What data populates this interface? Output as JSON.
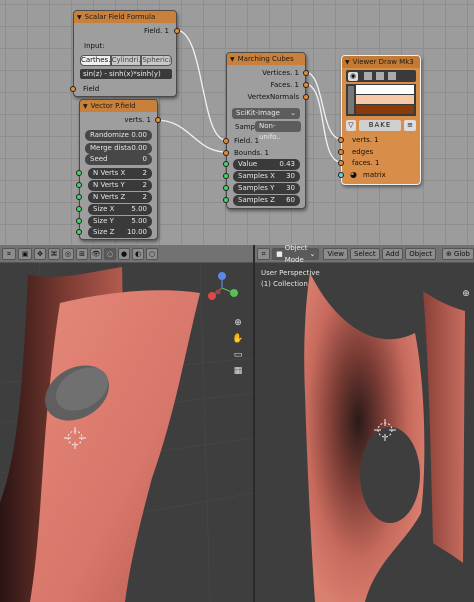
{
  "node_editor": {
    "nodes": {
      "scalar": {
        "title": "Scalar Field Formula",
        "out_field": "Field. 1",
        "input_label": "Input:",
        "modes": [
          "Carthes..",
          "Cylindri..",
          "Spherical"
        ],
        "formula": "sin(z) - sinh(x)*sinh(y)",
        "in_field": "Field"
      },
      "vector": {
        "title": "Vector P.field",
        "out_verts": "verts. 1",
        "params": [
          {
            "label": "Randomize",
            "value": "0.00"
          },
          {
            "label": "Merge dista",
            "value": "0.00"
          },
          {
            "label": "Seed",
            "value": "0"
          }
        ],
        "inputs": [
          {
            "label": "N Verts X",
            "value": "2"
          },
          {
            "label": "N Verts Y",
            "value": "2"
          },
          {
            "label": "N Verts Z",
            "value": "2"
          },
          {
            "label": "Size X",
            "value": "5.00"
          },
          {
            "label": "Size Y",
            "value": "5.00"
          },
          {
            "label": "Size Z",
            "value": "10.00"
          }
        ]
      },
      "marching": {
        "title": "Marching Cubes",
        "outputs": [
          "Vertices. 1",
          "Faces. 1",
          "VertexNormals"
        ],
        "backend": "SciKit-Image",
        "sampling_label": "Sampl",
        "sampling_value": "Non-unifo..",
        "in_field": "Field. 1",
        "in_bounds": "Bounds. 1",
        "inputs": [
          {
            "label": "Value",
            "value": "0.43"
          },
          {
            "label": "Samples X",
            "value": "30"
          },
          {
            "label": "Samples Y",
            "value": "30"
          },
          {
            "label": "Samples Z",
            "value": "60"
          }
        ]
      },
      "viewer": {
        "title": "Viewer Draw Mk3",
        "bake_label": "BAKE",
        "inputs": [
          "verts. 1",
          "edges",
          "faces. 1",
          "matrix"
        ],
        "swatches": [
          "#ffffff",
          "#f5c9a8",
          "#8a3b0a"
        ]
      }
    }
  },
  "viewport_left": {
    "mode": "Object Mode",
    "menus": [
      "View",
      "Select",
      "Add",
      "Object"
    ]
  },
  "viewport_right": {
    "mode": "Object Mode",
    "menus": [
      "View",
      "Select",
      "Add",
      "Object"
    ],
    "extra": "Glob",
    "overlay_line1": "User Perspective",
    "overlay_line2": "(1) Collection"
  },
  "colors": {
    "node_header": "#c8803a",
    "mesh": "#d9786a",
    "viewport_bg": "#3e3e3e",
    "socket_orange": "#e88a2e",
    "socket_green": "#3fd46a"
  }
}
